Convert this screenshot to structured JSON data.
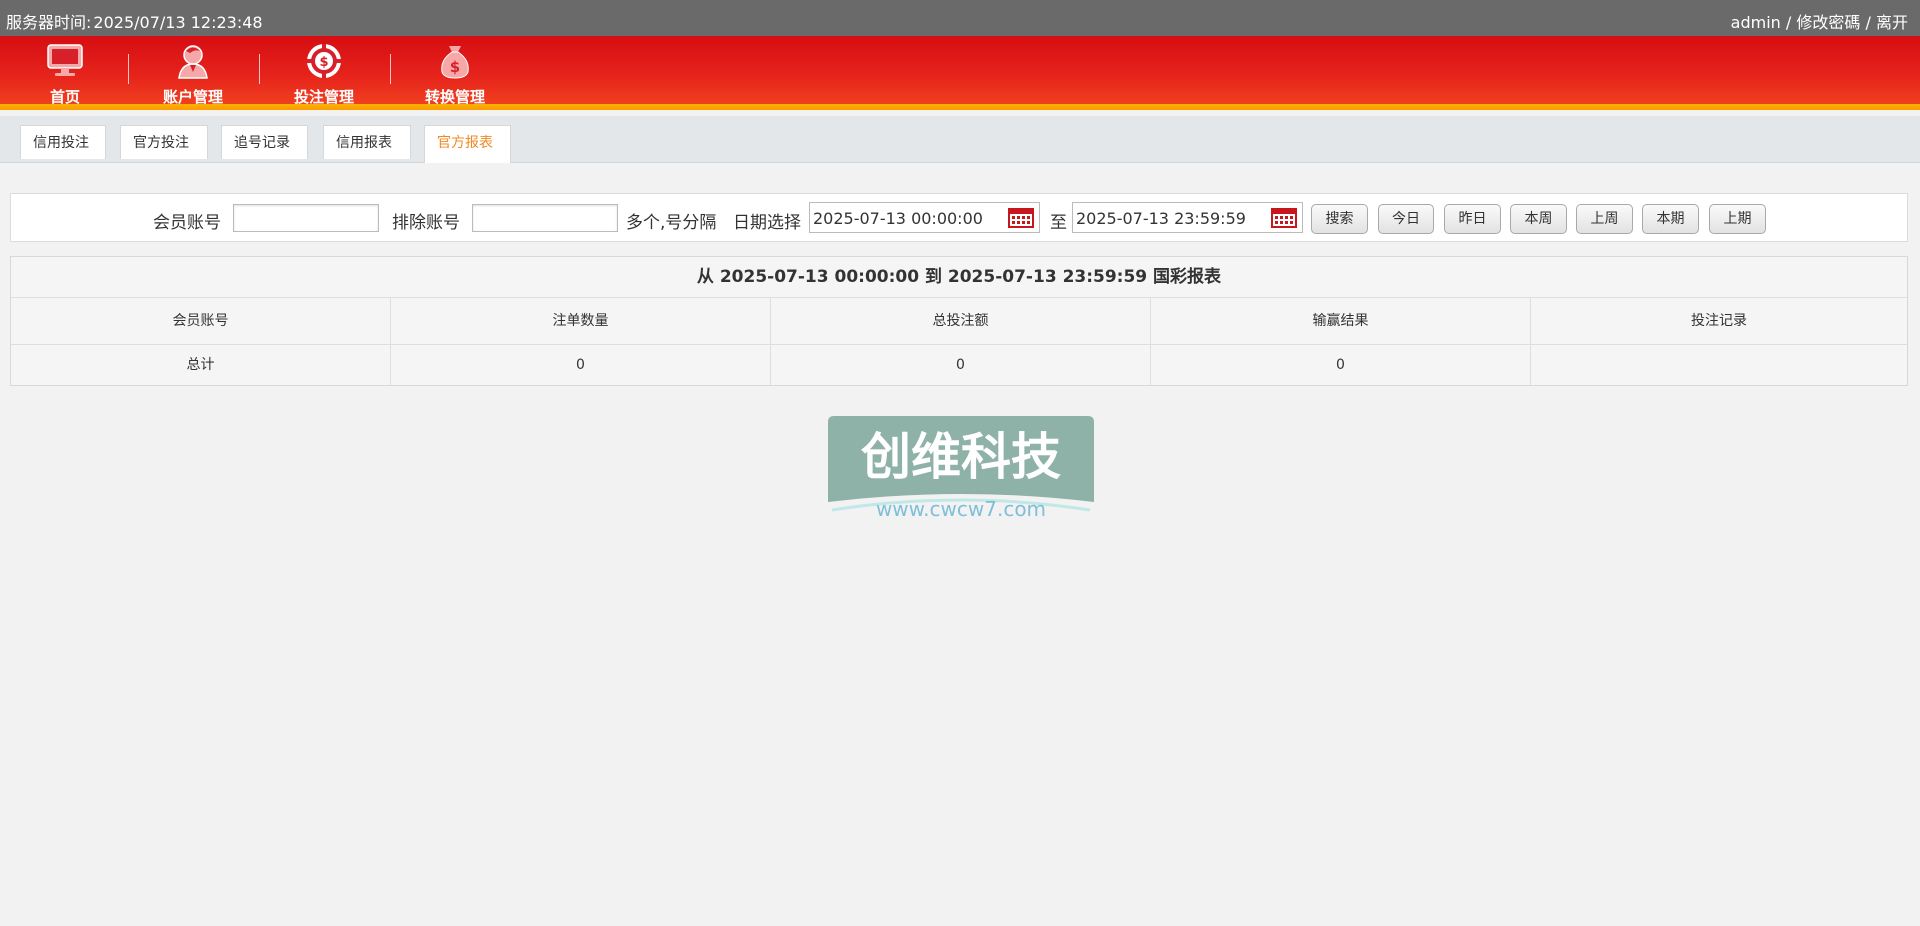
{
  "topbar": {
    "server_label": "服务器时间:",
    "server_time": "2025/07/13 12:23:48",
    "username": "admin",
    "separator": "/",
    "change_password": "修改密碼",
    "logout": "离开"
  },
  "nav": {
    "items": [
      {
        "label": "首页",
        "icon": "monitor-icon"
      },
      {
        "label": "账户管理",
        "icon": "user-icon"
      },
      {
        "label": "投注管理",
        "icon": "chip-icon"
      },
      {
        "label": "转换管理",
        "icon": "money-bag-icon"
      }
    ],
    "active_index": 2
  },
  "subnav": {
    "tabs": [
      "信用投注",
      "官方投注",
      "追号记录",
      "信用报表",
      "官方报表"
    ],
    "active_index": 4
  },
  "search": {
    "member_label": "会员账号",
    "member_value": "",
    "exclude_label": "排除账号",
    "exclude_value": "",
    "exclude_hint": "多个,号分隔",
    "date_label": "日期选择",
    "date_from": "2025-07-13 00:00:00",
    "to_label": "至",
    "date_to": "2025-07-13 23:59:59",
    "buttons": [
      "搜索",
      "今日",
      "昨日",
      "本周",
      "上周",
      "本期",
      "上期"
    ]
  },
  "report": {
    "title": "从 2025-07-13 00:00:00 到 2025-07-13 23:59:59 国彩报表",
    "columns": [
      "会员账号",
      "注单数量",
      "总投注额",
      "输赢结果",
      "投注记录"
    ],
    "total_row": [
      "总计",
      "0",
      "0",
      "0",
      ""
    ]
  },
  "watermark": {
    "text": "创维科技",
    "url": "www.cwcw7.com"
  },
  "colors": {
    "nav_red": "#d60d12",
    "nav_gold": "#f6b300",
    "active_tab": "#f08a24",
    "topbar": "#6a6a6a"
  }
}
